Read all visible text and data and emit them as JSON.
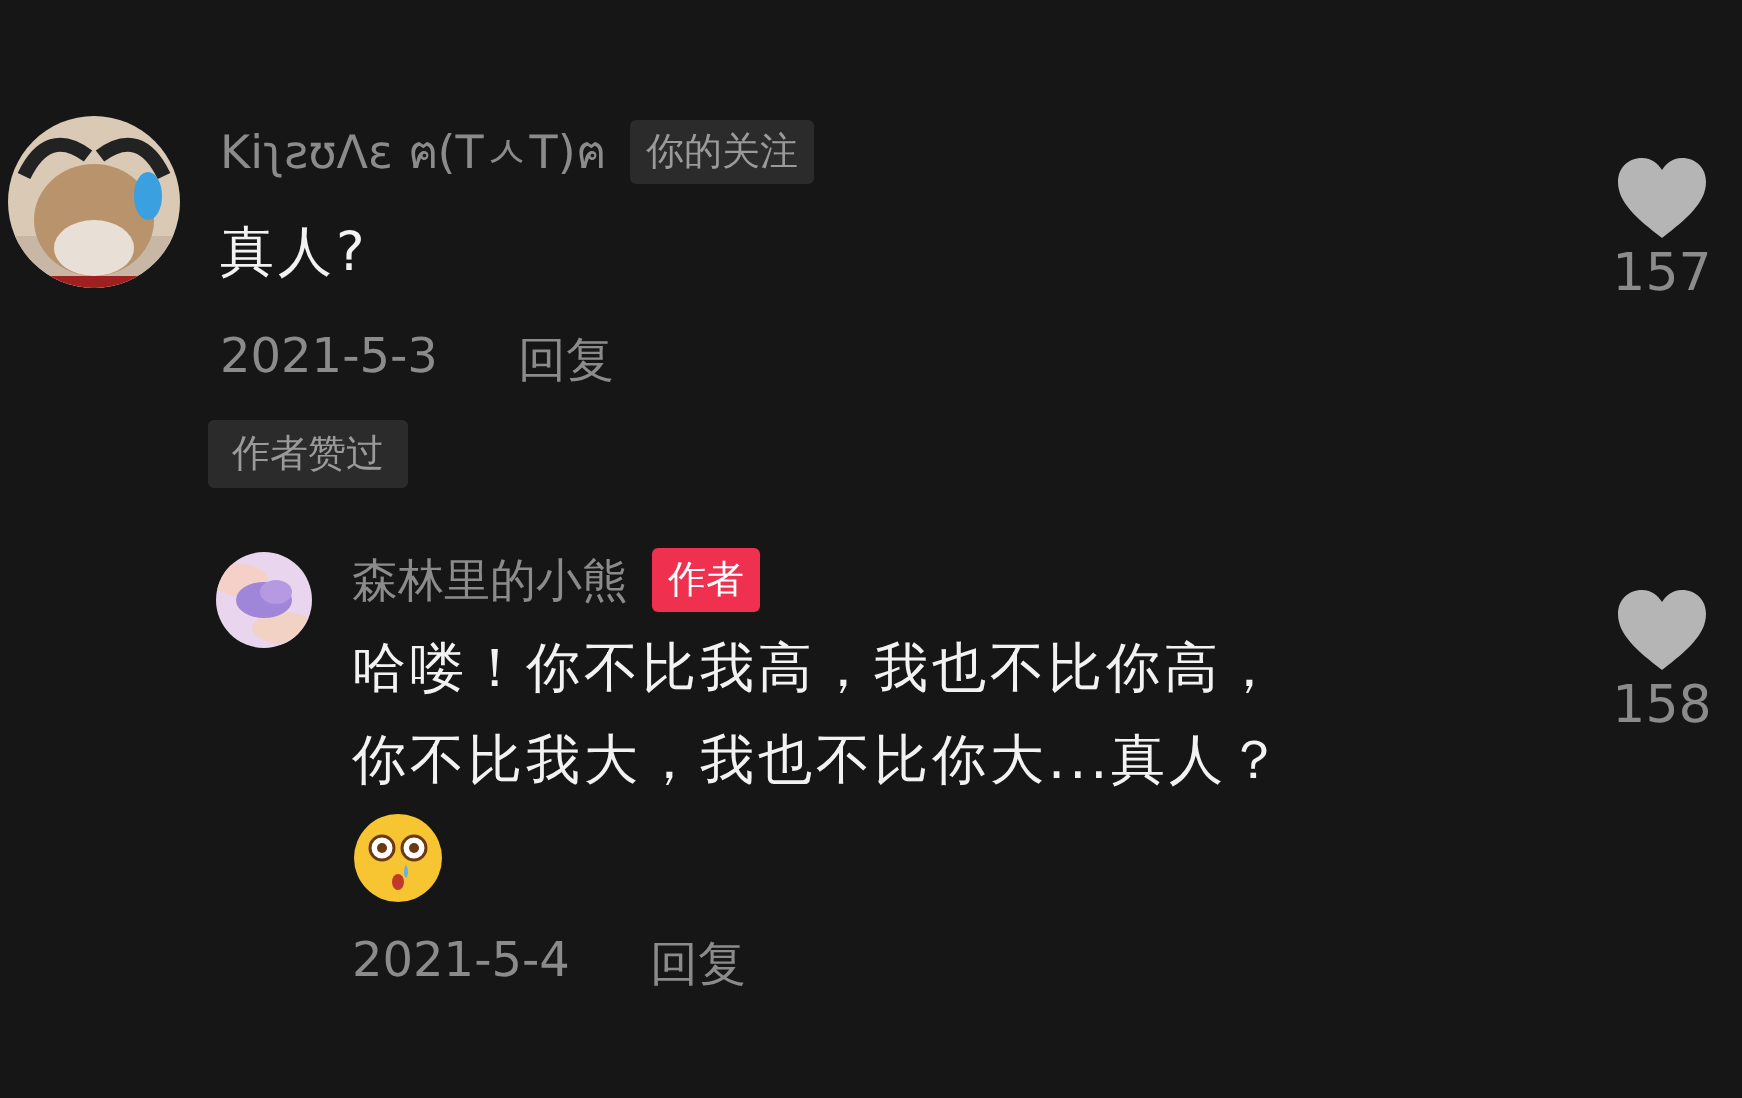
{
  "comments": [
    {
      "user": "Kiʅƨʊᐱɛ ฅ(TㅅT)ฅ",
      "badge": {
        "kind": "following",
        "label": "你的关注"
      },
      "text": "真人?",
      "date": "2021-5-3",
      "reply_label": "回复",
      "likes": "157",
      "tag": "作者赞过",
      "replies": [
        {
          "user": "森林里的小熊",
          "badge": {
            "kind": "author",
            "label": "作者"
          },
          "text": "哈喽！你不比我高，我也不比你高，你不比我大，我也不比你大...真人？",
          "emoji": true,
          "date": "2021-5-4",
          "reply_label": "回复",
          "likes": "158"
        }
      ]
    }
  ]
}
